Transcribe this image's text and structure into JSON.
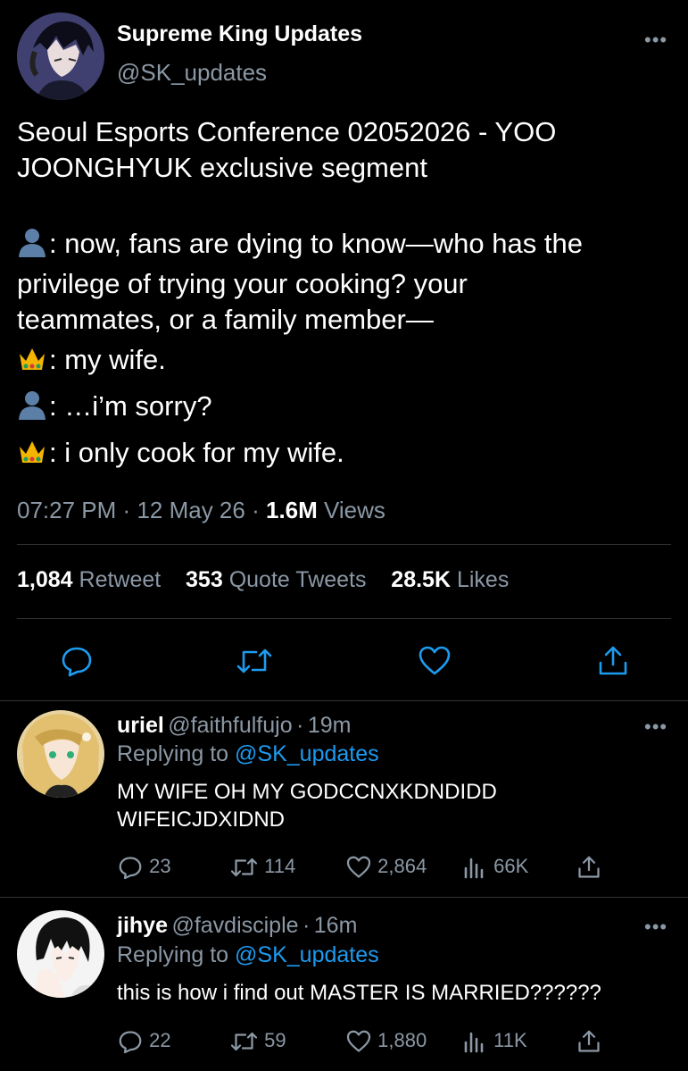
{
  "tweet": {
    "author_name": "Supreme King Updates",
    "author_handle": "@SK_updates",
    "more_label": "•••",
    "text_lines": [
      "Seoul Esports Conference 02052026 - YOO",
      "JOONGHYUK exclusive segment"
    ],
    "dialogue": [
      {
        "speaker_icon": "bust-silhouette-icon",
        "lines": [
          ": now, fans are dying to know—who has the",
          "privilege of trying your cooking? your",
          "teammates, or a family member—"
        ]
      },
      {
        "speaker_icon": "crown-icon",
        "lines": [
          ": my wife."
        ]
      },
      {
        "speaker_icon": "bust-silhouette-icon",
        "lines": [
          ": …i’m sorry?"
        ]
      },
      {
        "speaker_icon": "crown-icon",
        "lines": [
          ": i only cook for my wife."
        ]
      }
    ],
    "time": "07:27 PM",
    "date": "12 May 26",
    "separator": "·",
    "views_count": "1.6M",
    "views_label": "Views",
    "retweets_count": "1,084",
    "retweets_label": "Retweet",
    "quotes_count": "353",
    "quotes_label": "Quote Tweets",
    "likes_count": "28.5K",
    "likes_label": "Likes"
  },
  "replies": [
    {
      "name": "uriel",
      "handle": "@faithfulfujo",
      "time": "19m",
      "replying_prefix": "Replying to",
      "replying_to": "@SK_updates",
      "text_lines": [
        "MY WIFE OH MY GODCCNXKDNDIDD",
        "WIFEICJDXIDND"
      ],
      "comments": "23",
      "retweets": "114",
      "likes": "2,864",
      "views": "66K"
    },
    {
      "name": "jihye",
      "handle": "@favdisciple",
      "time": "16m",
      "replying_prefix": "Replying to",
      "replying_to": "@SK_updates",
      "text_lines": [
        "this is how i find out MASTER IS MARRIED??????"
      ],
      "comments": "22",
      "retweets": "59",
      "likes": "1,880",
      "views": "11K"
    }
  ],
  "colors": {
    "background": "#000000",
    "text": "#ffffff",
    "secondary": "#8b98a5",
    "link": "#1d9bf0",
    "divider": "#2f3336"
  }
}
